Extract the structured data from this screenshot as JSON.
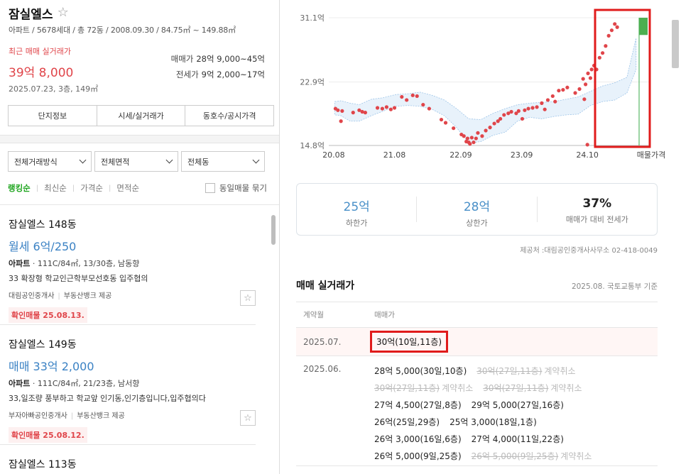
{
  "complex": {
    "title": "잠실엘스",
    "meta": "아파트 / 5678세대 / 총 72동 / 2008.09.30 / 84.75㎡ ~ 149.88㎡",
    "recent_label": "최근 매매 실거래가",
    "recent_price": "39억 8,000",
    "recent_date": "2025.07.23, 3층, 149㎡",
    "sale_label": "매매가",
    "sale_range": "28억 9,000~45억",
    "jeonse_label": "전세가",
    "jeonse_range": "9억 2,000~17억"
  },
  "info_tabs": [
    "단지정보",
    "시세/실거래가",
    "동호수/공시가격"
  ],
  "filters": [
    "전체거래방식",
    "전체면적",
    "전체동"
  ],
  "sort": {
    "options": [
      "랭킹순",
      "최신순",
      "가격순",
      "면적순"
    ],
    "active": "랭킹순",
    "same_listing": "동일매물 묶기"
  },
  "listings": [
    {
      "name": "잠실엘스 148동",
      "price": "월세 6억/250",
      "type": "아파트",
      "spec": "111C/84㎡, 13/30층, 남동향",
      "desc": "33 확장형 학교인근학부모선호동 입주협의",
      "agent": "대림공인중개사",
      "provider": "부동산뱅크 제공",
      "confirm": "확인매물 25.08.13."
    },
    {
      "name": "잠실엘스 149동",
      "price": "매매 33억 2,000",
      "type": "아파트",
      "spec": "111C/84㎡, 21/23층, 남서향",
      "desc": "33,일조량 풍부하고 학교앞 인기동,인기층입니다,입주협의다",
      "agent": "부자아빠공인중개사",
      "provider": "부동산뱅크 제공",
      "confirm": "확인매물 25.08.12."
    },
    {
      "name": "잠실엘스 113동"
    }
  ],
  "chart_data": {
    "type": "scatter",
    "y_ticks": [
      "31.1억",
      "22.9억",
      "14.8억"
    ],
    "ylim": [
      14.8,
      31.1
    ],
    "x_ticks": [
      "20.08",
      "21.08",
      "22.09",
      "23.09",
      "24.10"
    ],
    "x_extra_label": "매물가격",
    "listing_price_range": [
      28.9,
      31.1
    ],
    "band": {
      "x": [
        2020.6,
        2020.7,
        2020.85,
        2021.0,
        2021.2,
        2021.4,
        2021.6,
        2021.8,
        2022.0,
        2022.2,
        2022.4,
        2022.6,
        2022.8,
        2023.0,
        2023.2,
        2023.4,
        2023.6,
        2023.8,
        2024.0,
        2024.2,
        2024.4,
        2024.6,
        2024.8,
        2025.0,
        2025.2,
        2025.4,
        2025.55
      ],
      "upper": [
        20.4,
        20.5,
        20.2,
        20.0,
        20.7,
        20.9,
        21.3,
        21.4,
        21.6,
        21.2,
        20.6,
        19.5,
        18.2,
        18.1,
        18.9,
        19.5,
        20.0,
        20.2,
        20.3,
        20.4,
        20.7,
        21.0,
        21.7,
        22.4,
        22.8,
        23.5,
        28.5
      ],
      "lower": [
        18.7,
        18.6,
        17.9,
        17.9,
        18.6,
        19.2,
        19.8,
        19.9,
        19.8,
        19.4,
        18.6,
        17.1,
        15.1,
        15.3,
        16.1,
        16.5,
        17.9,
        18.4,
        18.2,
        18.5,
        18.7,
        18.8,
        19.9,
        20.4,
        20.6,
        21.5,
        24.5
      ]
    },
    "points": [
      [
        2020.61,
        19.5
      ],
      [
        2020.65,
        19.3
      ],
      [
        2020.7,
        17.9
      ],
      [
        2020.72,
        19.2
      ],
      [
        2020.9,
        19.0
      ],
      [
        2021.0,
        19.3
      ],
      [
        2021.05,
        19.1
      ],
      [
        2021.1,
        19.0
      ],
      [
        2021.3,
        19.6
      ],
      [
        2021.38,
        19.5
      ],
      [
        2021.45,
        19.7
      ],
      [
        2021.52,
        19.4
      ],
      [
        2021.58,
        19.6
      ],
      [
        2021.7,
        21.0
      ],
      [
        2021.78,
        20.6
      ],
      [
        2021.88,
        21.2
      ],
      [
        2021.95,
        21.1
      ],
      [
        2022.05,
        20.0
      ],
      [
        2022.15,
        19.5
      ],
      [
        2022.35,
        18.1
      ],
      [
        2022.42,
        17.7
      ],
      [
        2022.55,
        17.0
      ],
      [
        2022.68,
        16.2
      ],
      [
        2022.72,
        16.0
      ],
      [
        2022.76,
        15.3
      ],
      [
        2022.78,
        15.7
      ],
      [
        2022.8,
        15.2
      ],
      [
        2022.82,
        15.0
      ],
      [
        2022.85,
        15.8
      ],
      [
        2022.88,
        15.2
      ],
      [
        2022.92,
        15.7
      ],
      [
        2022.95,
        16.4
      ],
      [
        2023.02,
        16.0
      ],
      [
        2023.08,
        16.7
      ],
      [
        2023.15,
        17.1
      ],
      [
        2023.22,
        17.6
      ],
      [
        2023.28,
        17.9
      ],
      [
        2023.32,
        18.2
      ],
      [
        2023.38,
        18.7
      ],
      [
        2023.45,
        18.9
      ],
      [
        2023.5,
        19.1
      ],
      [
        2023.58,
        18.9
      ],
      [
        2023.62,
        19.2
      ],
      [
        2023.68,
        18.2
      ],
      [
        2023.72,
        19.3
      ],
      [
        2023.78,
        19.5
      ],
      [
        2023.85,
        19.6
      ],
      [
        2023.92,
        19.7
      ],
      [
        2024.0,
        20.2
      ],
      [
        2024.05,
        19.4
      ],
      [
        2024.1,
        20.6
      ],
      [
        2024.18,
        21.1
      ],
      [
        2024.22,
        20.4
      ],
      [
        2024.28,
        21.8
      ],
      [
        2024.35,
        21.9
      ],
      [
        2024.42,
        22.2
      ],
      [
        2024.55,
        21.5
      ],
      [
        2024.62,
        22.0
      ],
      [
        2024.68,
        23.3
      ],
      [
        2024.72,
        22.6
      ],
      [
        2024.76,
        24.0
      ],
      [
        2024.8,
        23.4
      ],
      [
        2024.82,
        24.5
      ],
      [
        2024.86,
        25.0
      ],
      [
        2024.9,
        24.5
      ],
      [
        2024.95,
        26.0
      ],
      [
        2025.0,
        26.6
      ],
      [
        2025.05,
        27.5
      ],
      [
        2025.1,
        28.8
      ],
      [
        2025.15,
        29.5
      ],
      [
        2025.2,
        30.3
      ],
      [
        2025.24,
        29.9
      ],
      [
        2024.7,
        20.7
      ],
      [
        2024.75,
        14.9
      ]
    ]
  },
  "price_summary": {
    "lower_value": "25억",
    "lower_label": "하한가",
    "upper_value": "28억",
    "upper_label": "상한가",
    "ratio_value": "37%",
    "ratio_label": "매매가 대비 전세가"
  },
  "source": "제공처 :대림공인중개사사무소 02-418-0049",
  "deals": {
    "title": "매매 실거래가",
    "basis": "2025.08. 국토교통부 기준",
    "col_month": "계약월",
    "col_price": "매매가",
    "rows": [
      {
        "month": "2025.07.",
        "lines": [
          [
            "30억(10일,11층)"
          ]
        ]
      },
      {
        "month": "2025.06.",
        "lines": []
      }
    ],
    "june": {
      "l1a": "28억 5,000(30일,10층)",
      "l1b": "30억(27일,11층)",
      "l1b_tag": "계약취소",
      "l2a": "30억(27일,11층)",
      "l2a_tag": "계약취소",
      "l2b": "30억(27일,11층)",
      "l2b_tag": "계약취소",
      "l3a": "27억 4,500(27일,8층)",
      "l3b": "29억 5,000(27일,16층)",
      "l4a": "26억(25일,29층)",
      "l4b": "25억 3,000(18일,1층)",
      "l5a": "26억 3,000(16일,6층)",
      "l5b": "27억 4,000(11일,22층)",
      "l6a": "26억 5,000(9일,25층)",
      "l6b": "26억 5,000(9일,25층)",
      "l6b_tag": "계약취소"
    }
  },
  "colors": {
    "accent_red": "#e0454a",
    "blue": "#4a90c8",
    "green": "#1fa51f",
    "highlight": "#e01b1b"
  }
}
